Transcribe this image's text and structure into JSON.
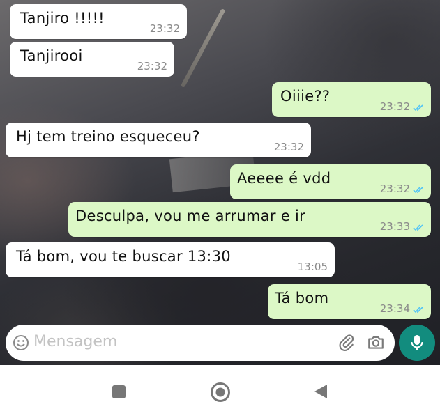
{
  "messages": [
    {
      "direction": "in",
      "text": "Tanjiro !!!!!",
      "time": "23:32"
    },
    {
      "direction": "in",
      "text": "Tanjirooi",
      "time": "23:32"
    },
    {
      "direction": "out",
      "text": "Oiiie??",
      "time": "23:32",
      "status": "read"
    },
    {
      "direction": "in",
      "text": "Hj tem treino esqueceu?",
      "time": "23:32"
    },
    {
      "direction": "out",
      "text": "Aeeee é vdd",
      "time": "23:32",
      "status": "read"
    },
    {
      "direction": "out",
      "text": "Desculpa, vou me arrumar e ir",
      "time": "23:33",
      "status": "read"
    },
    {
      "direction": "in",
      "text": "Tá bom, vou te buscar 13:30",
      "time": "13:05"
    },
    {
      "direction": "out",
      "text": "Tá bom",
      "time": "23:34",
      "status": "read"
    }
  ],
  "composer": {
    "placeholder": "Mensagem"
  },
  "icons": {
    "emoji": "emoji-icon",
    "attach": "paperclip-icon",
    "camera": "camera-icon",
    "mic": "mic-icon",
    "nav_recents": "square-icon",
    "nav_home": "circle-icon",
    "nav_back": "triangle-back-icon"
  },
  "colors": {
    "incoming_bubble": "#ffffff",
    "outgoing_bubble": "#dcf8c6",
    "read_ticks": "#4fc3f7",
    "mic_button": "#128c7e",
    "timestamp": "#8a8a8a"
  }
}
